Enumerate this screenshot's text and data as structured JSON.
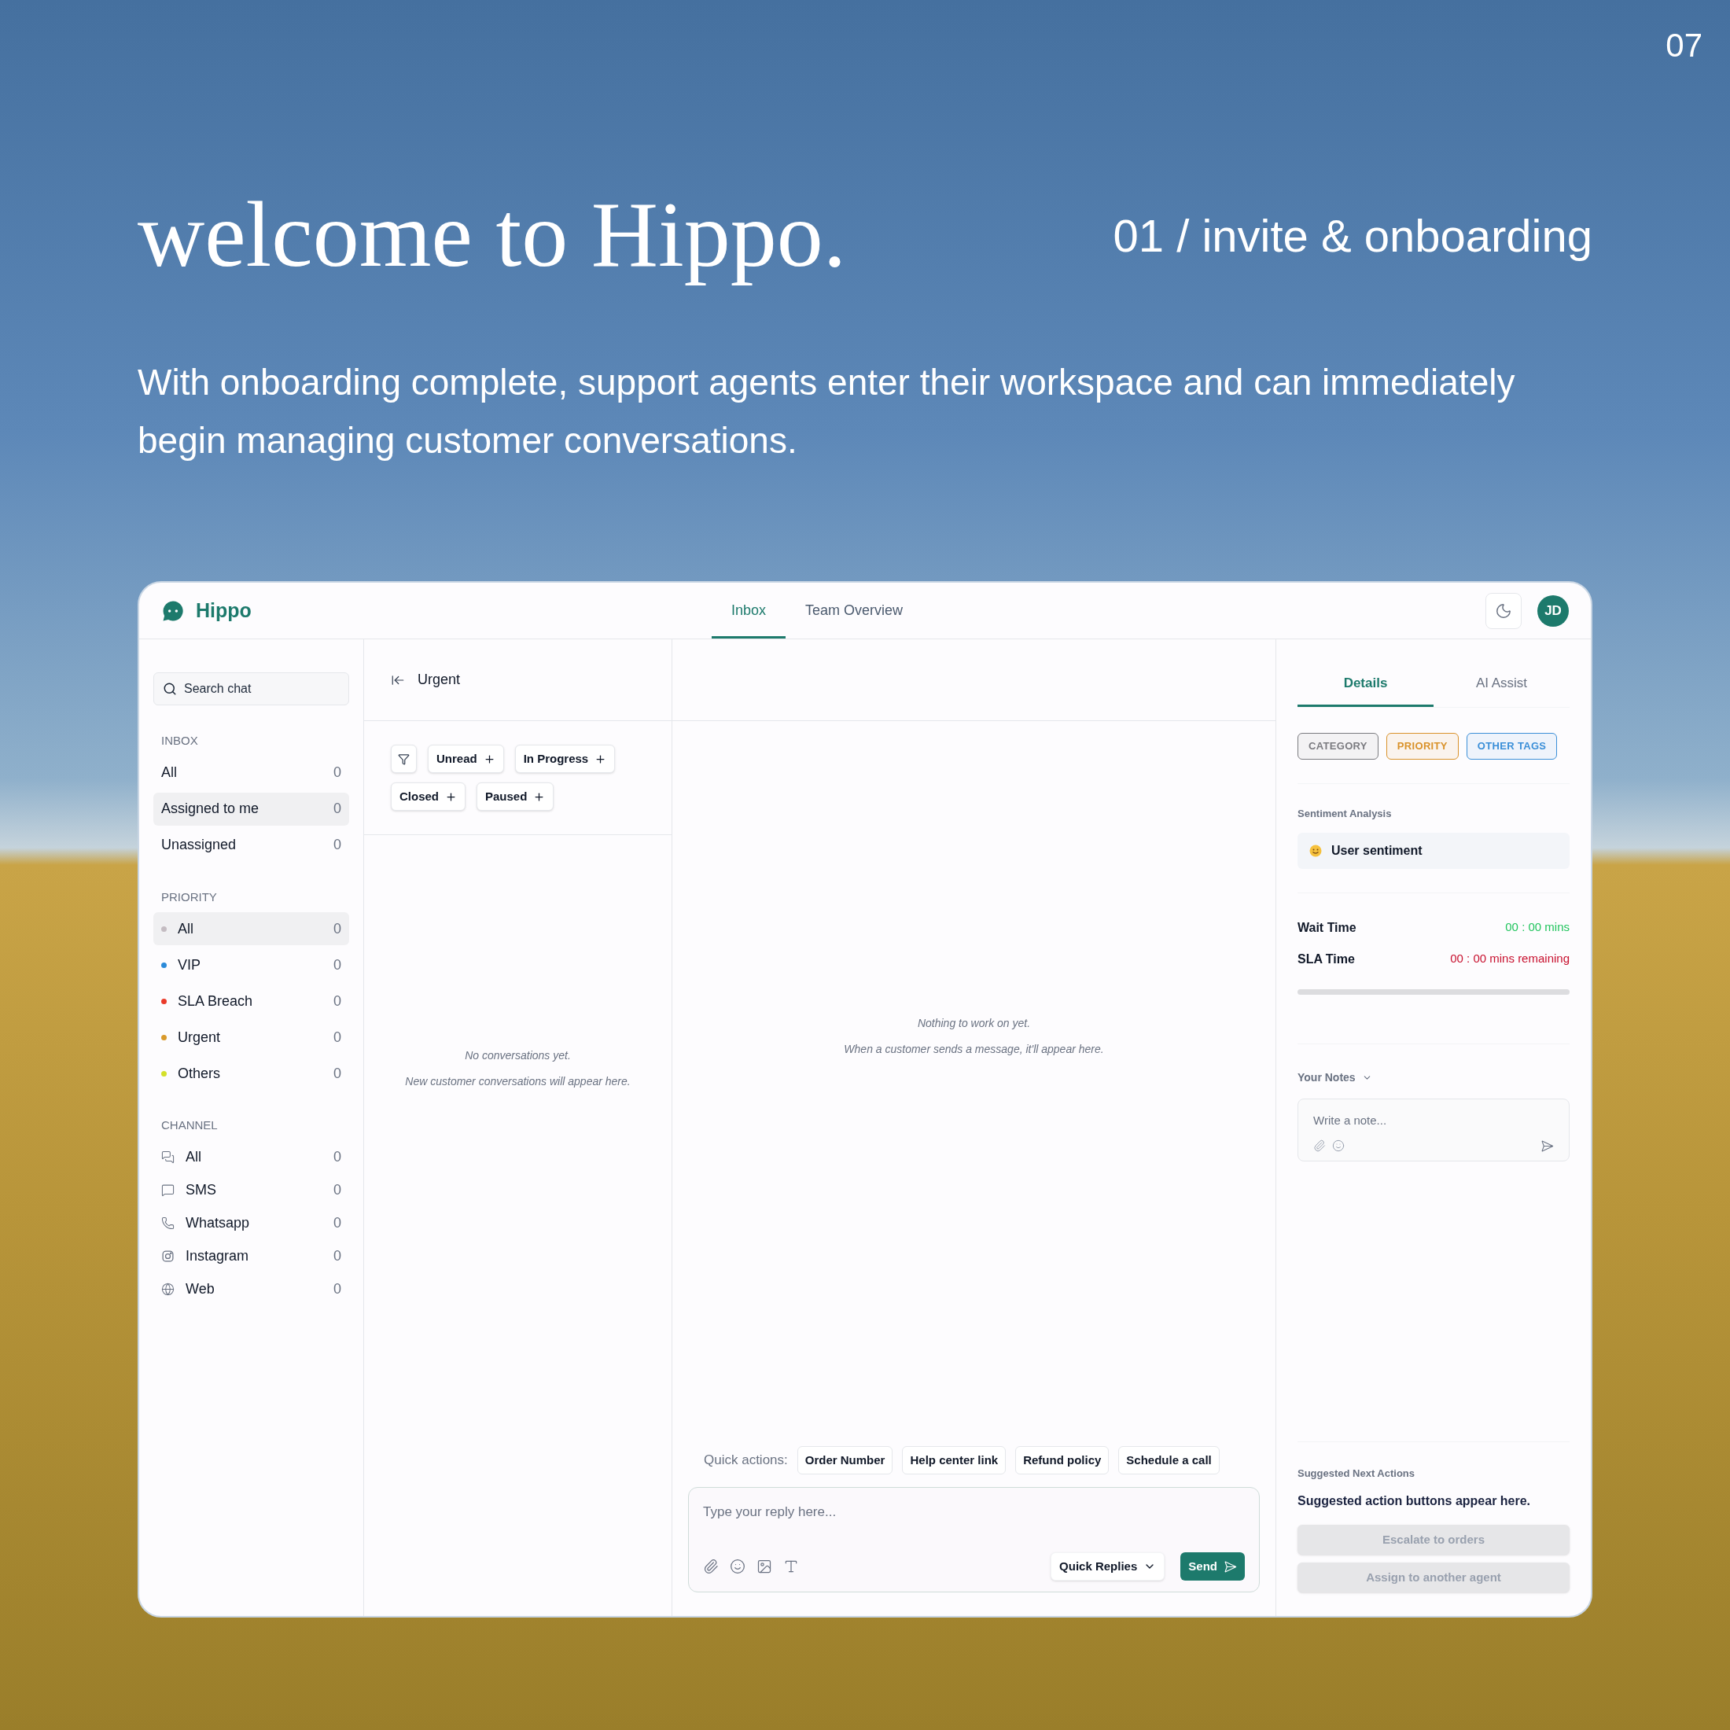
{
  "slide_number": "07",
  "headline": "welcome to Hippo.",
  "section": "01 / invite & onboarding",
  "description": "With onboarding complete, support agents enter their workspace and can immediately begin managing customer conversations.",
  "app": {
    "brand": "Hippo",
    "nav_tabs": [
      {
        "label": "Inbox",
        "selected": true
      },
      {
        "label": "Team Overview",
        "selected": false
      }
    ],
    "avatar": "JD",
    "sidebar": {
      "search": {
        "placeholder": "Search chat"
      },
      "sections": [
        {
          "title": "INBOX",
          "kind": "plain",
          "items": [
            {
              "label": "All",
              "count": "0",
              "selected": false
            },
            {
              "label": "Assigned to me",
              "count": "0",
              "selected": true
            },
            {
              "label": "Unassigned",
              "count": "0",
              "selected": false
            }
          ]
        },
        {
          "title": "PRIORITY",
          "kind": "dot",
          "items": [
            {
              "label": "All",
              "count": "0",
              "selected": true,
              "color": "#c4bcc2"
            },
            {
              "label": "VIP",
              "count": "0",
              "selected": false,
              "color": "#2b8ad9"
            },
            {
              "label": "SLA Breach",
              "count": "0",
              "selected": false,
              "color": "#ea3a2a"
            },
            {
              "label": "Urgent",
              "count": "0",
              "selected": false,
              "color": "#d99a2b"
            },
            {
              "label": "Others",
              "count": "0",
              "selected": false,
              "color": "#d4e02a"
            }
          ]
        },
        {
          "title": "CHANNEL",
          "kind": "icon",
          "items": [
            {
              "label": "All",
              "count": "0",
              "selected": false,
              "kind": "chats"
            },
            {
              "label": "SMS",
              "count": "0",
              "selected": false,
              "kind": "sms"
            },
            {
              "label": "Whatsapp",
              "count": "0",
              "selected": false,
              "kind": "phone"
            },
            {
              "label": "Instagram",
              "count": "0",
              "selected": false,
              "kind": "instagram"
            },
            {
              "label": "Web",
              "count": "0",
              "selected": false,
              "kind": "web"
            }
          ]
        }
      ]
    },
    "conversation_list": {
      "title": "Urgent",
      "filters": [
        "Unread",
        "In Progress",
        "Closed",
        "Paused"
      ],
      "empty_lines": [
        "No conversations yet.",
        "New customer conversations will appear here."
      ]
    },
    "chat": {
      "empty_lines": [
        "Nothing to work on yet.",
        "When a customer sends a message, it'll appear here."
      ],
      "quick_actions_label": "Quick actions:",
      "quick_actions": [
        "Order Number",
        "Help center link",
        "Refund policy",
        "Schedule a call"
      ],
      "composer": {
        "placeholder": "Type your reply here..."
      },
      "quick_replies": "Quick Replies",
      "send": "Send"
    },
    "details": {
      "tabs": [
        {
          "label": "Details",
          "selected": true
        },
        {
          "label": "AI Assist",
          "selected": false
        }
      ],
      "tags": [
        {
          "label": "CATEGORY",
          "color": "#7b7b80"
        },
        {
          "label": "PRIORITY",
          "color": "#d9922b"
        },
        {
          "label": "OTHER TAGS",
          "color": "#3b8fd8"
        }
      ],
      "sentiment_title": "Sentiment Analysis",
      "sentiment": "User sentiment",
      "timers": [
        {
          "label": "Wait Time",
          "value": "00 : 00 mins",
          "color": "#22c55e"
        },
        {
          "label": "SLA Time",
          "value": "00 : 00 mins remaining",
          "color": "#c8102e"
        }
      ],
      "sla_progress": {
        "level": 0
      },
      "notes_title": "Your Notes",
      "notes": {
        "placeholder": "Write a note..."
      },
      "suggested_title": "Suggested Next Actions",
      "suggested_text": "Suggested action buttons appear here.",
      "suggested_actions": [
        {
          "label": "Escalate to orders",
          "disabled": true
        },
        {
          "label": "Assign to another agent",
          "disabled": true
        }
      ]
    }
  }
}
